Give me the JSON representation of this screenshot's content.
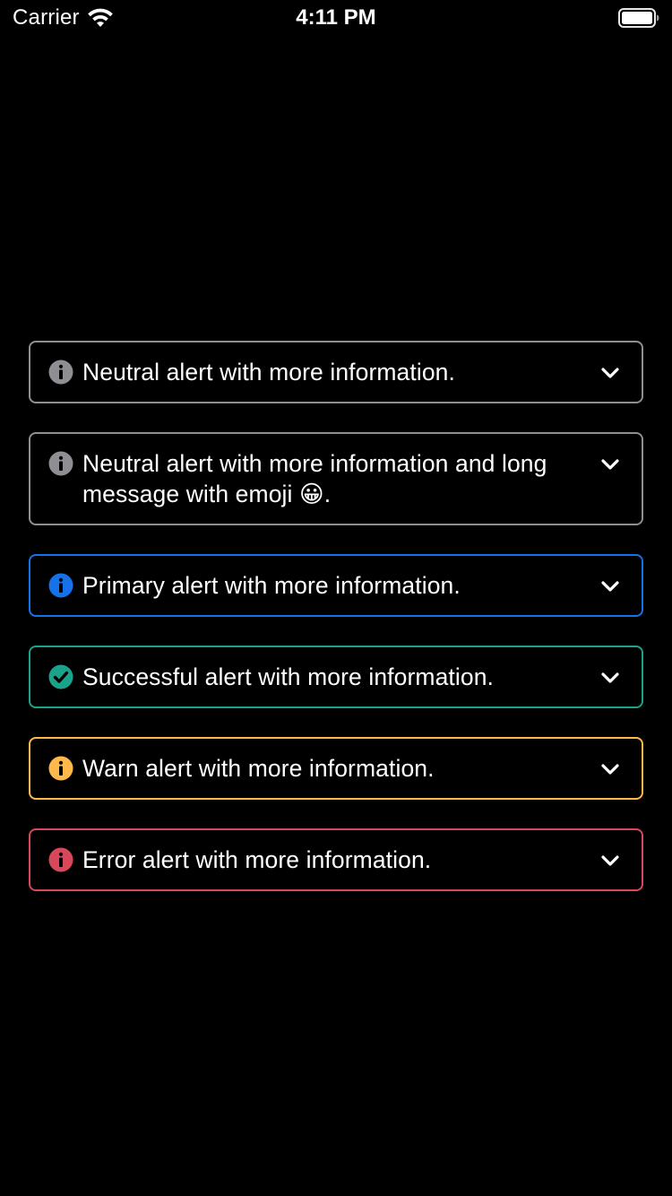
{
  "status_bar": {
    "carrier": "Carrier",
    "time": "4:11 PM",
    "wifi_icon": "wifi-icon",
    "battery_icon": "battery-icon"
  },
  "colors": {
    "background": "#000000",
    "neutral": "#8e8e93",
    "primary": "#1672e8",
    "success": "#1aa38a",
    "warn": "#ffb84a",
    "error": "#d8485a"
  },
  "alerts": [
    {
      "type": "neutral",
      "icon": "info-icon",
      "message": "Neutral alert with more information."
    },
    {
      "type": "neutral",
      "icon": "info-icon",
      "message": "Neutral alert with more information and long message with emoji 😀."
    },
    {
      "type": "primary",
      "icon": "info-icon",
      "message": "Primary alert with more information."
    },
    {
      "type": "success",
      "icon": "check-circle-icon",
      "message": "Successful alert with more information."
    },
    {
      "type": "warn",
      "icon": "info-icon",
      "message": "Warn alert with more information."
    },
    {
      "type": "error",
      "icon": "info-icon",
      "message": "Error alert with more information."
    }
  ]
}
